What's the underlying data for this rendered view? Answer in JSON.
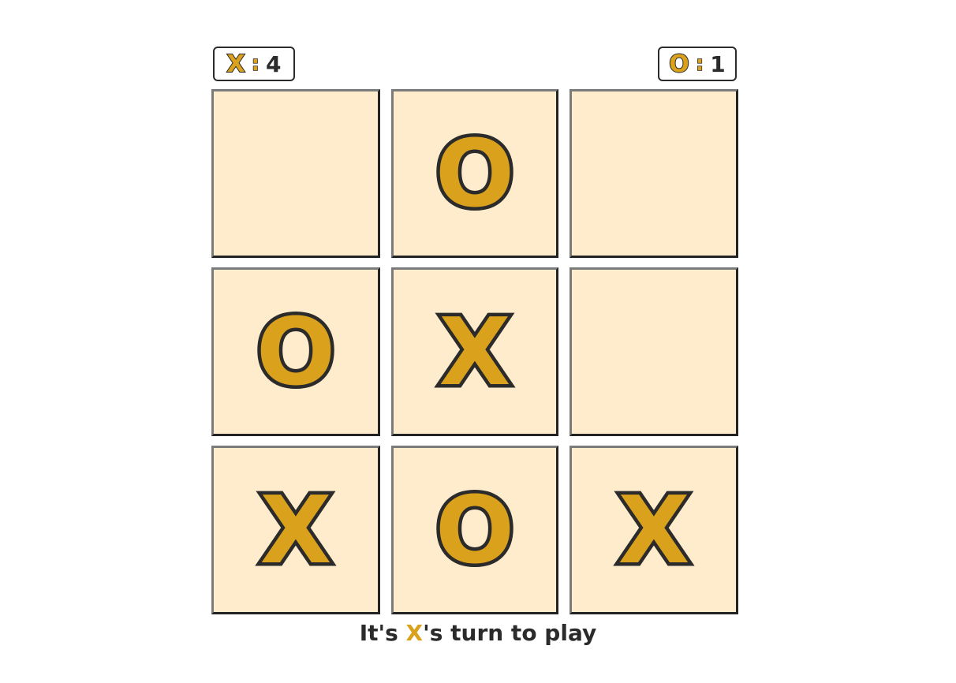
{
  "colors": {
    "accent": "#daa21c",
    "outline": "#2b2b2b",
    "cell_bg": "#ffeccc"
  },
  "score": {
    "x": {
      "symbol": "X",
      "separator": ":",
      "value": "4"
    },
    "o": {
      "symbol": "O",
      "separator": ":",
      "value": "1"
    }
  },
  "board": {
    "cells": [
      "",
      "O",
      "",
      "O",
      "X",
      "",
      "X",
      "O",
      "X"
    ]
  },
  "status": {
    "prefix": "It's ",
    "player": "X",
    "suffix": "'s turn to play"
  }
}
